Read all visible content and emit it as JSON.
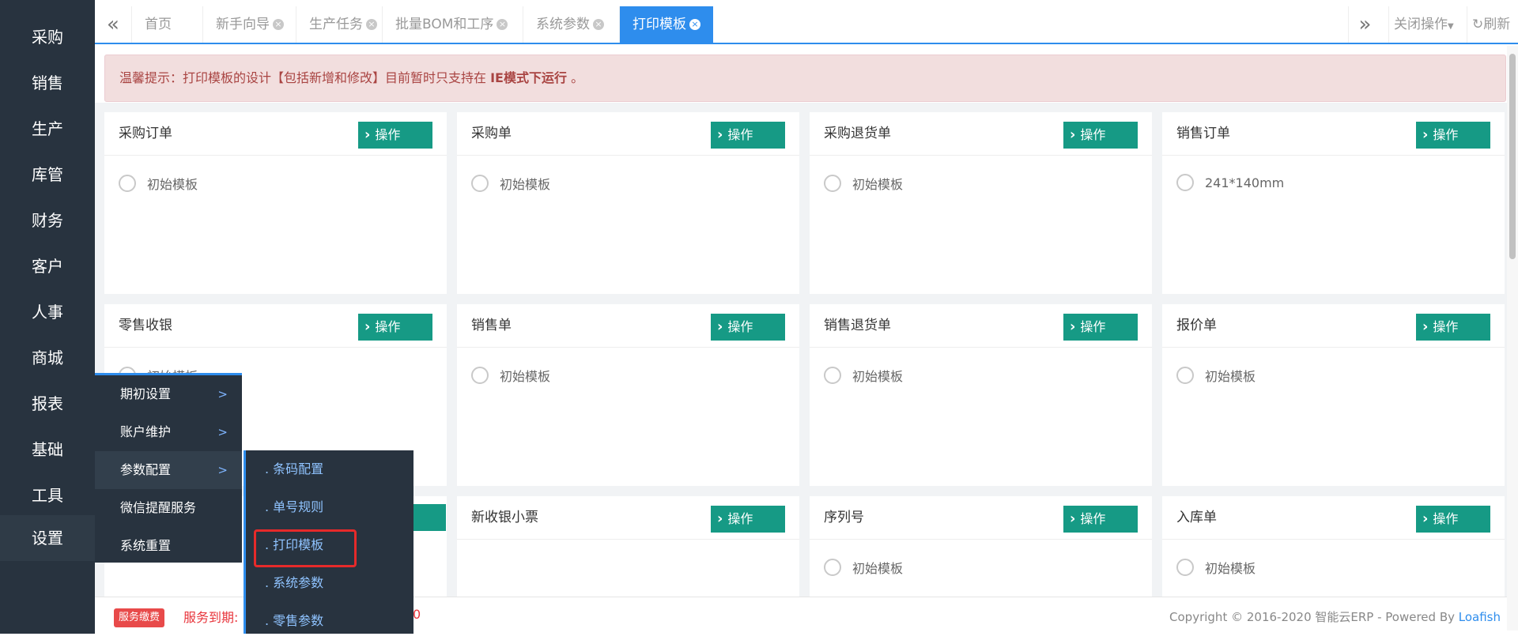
{
  "nav": {
    "items": [
      "采购",
      "销售",
      "生产",
      "库管",
      "财务",
      "客户",
      "人事",
      "商城",
      "报表",
      "基础",
      "工具",
      "设置"
    ]
  },
  "tabbar": {
    "tabs": [
      {
        "label": "首页",
        "closable": false
      },
      {
        "label": "新手向导",
        "closable": true
      },
      {
        "label": "生产任务",
        "closable": true
      },
      {
        "label": "批量BOM和工序",
        "closable": true
      },
      {
        "label": "系统参数",
        "closable": true
      },
      {
        "label": "打印模板",
        "closable": true,
        "active": true
      }
    ],
    "close_ops": "关闭操作",
    "refresh": "刷新"
  },
  "notice": {
    "prefix": "温馨提示：打印模板的设计【包括新增和修改】目前暂时只支持在 ",
    "bold": "IE模式下运行",
    "suffix": " 。"
  },
  "cards": [
    {
      "title": "采购订单",
      "button": "操作",
      "options": [
        "初始模板"
      ]
    },
    {
      "title": "采购单",
      "button": "操作",
      "options": [
        "初始模板"
      ]
    },
    {
      "title": "采购退货单",
      "button": "操作",
      "options": [
        "初始模板"
      ]
    },
    {
      "title": "销售订单",
      "button": "操作",
      "options": [
        "241*140mm"
      ]
    },
    {
      "title": "零售收银",
      "button": "操作",
      "options": [
        "初始模板"
      ]
    },
    {
      "title": "销售单",
      "button": "操作",
      "options": [
        "初始模板"
      ]
    },
    {
      "title": "销售退货单",
      "button": "操作",
      "options": [
        "初始模板"
      ]
    },
    {
      "title": "报价单",
      "button": "操作",
      "options": [
        "初始模板"
      ]
    },
    {
      "title": "新收银小票",
      "button": "操作",
      "options": []
    },
    {
      "title": "序列号",
      "button": "操作",
      "options": [
        "初始模板"
      ]
    },
    {
      "title": "入库单",
      "button": "操作",
      "options": [
        "初始模板"
      ]
    }
  ],
  "menu1": {
    "items": [
      {
        "label": "期初设置",
        "arrow": ">"
      },
      {
        "label": "账户维护",
        "arrow": ">"
      },
      {
        "label": "参数配置",
        "arrow": ">"
      },
      {
        "label": "微信提醒服务",
        "arrow": ""
      },
      {
        "label": "系统重置",
        "arrow": ""
      }
    ]
  },
  "menu2": {
    "items": [
      ". 条码配置",
      ". 单号规则",
      ". 打印模板",
      ". 系统参数",
      ". 零售参数"
    ]
  },
  "footer": {
    "pay_badge": "服务缴费",
    "expire": "服务到期:",
    "expire_tail": "0",
    "copyright": "Copyright © 2016-2020 智能云ERP - Powered By ",
    "link": "Loafish"
  },
  "colors": {
    "nav_bg": "#28333f",
    "accent": "#2e8ded",
    "op_button": "#169a85",
    "notice_bg": "#f2dede",
    "notice_text": "#a94442",
    "highlight_box": "#e62a2a"
  }
}
